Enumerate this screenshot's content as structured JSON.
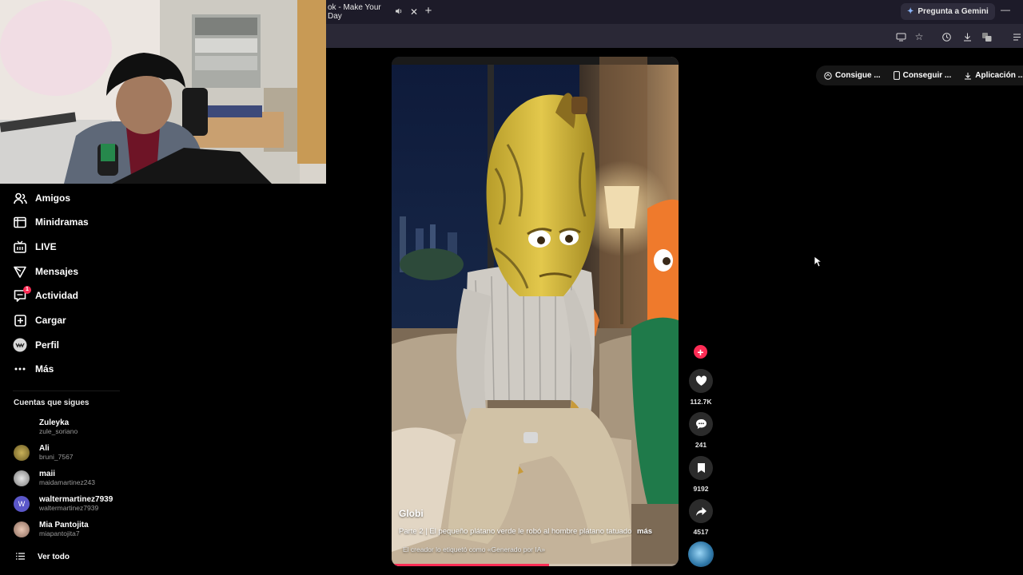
{
  "browser": {
    "tab_title": "ok - Make Your Day",
    "gemini_label": "Pregunta a Gemini",
    "toolbar_icons": [
      "screen-share-icon",
      "star-icon",
      "history-icon",
      "download-icon",
      "translate-icon",
      "reading-list-icon"
    ]
  },
  "nav": {
    "items": [
      {
        "label": "Amigos",
        "icon": "friends-icon"
      },
      {
        "label": "Minidramas",
        "icon": "minidramas-icon"
      },
      {
        "label": "LIVE",
        "icon": "live-icon"
      },
      {
        "label": "Mensajes",
        "icon": "messages-icon"
      },
      {
        "label": "Actividad",
        "icon": "activity-icon",
        "badge": "1"
      },
      {
        "label": "Cargar",
        "icon": "upload-icon"
      },
      {
        "label": "Perfil",
        "icon": "profile-avatar"
      },
      {
        "label": "Más",
        "icon": "more-icon"
      }
    ]
  },
  "following": {
    "title": "Cuentas que sigues",
    "accounts": [
      {
        "name": "Zuleyka",
        "handle": "zule_soriano"
      },
      {
        "name": "Ali",
        "handle": "bruni_7567"
      },
      {
        "name": "maii",
        "handle": "maidamartinez243"
      },
      {
        "name": "waltermartinez7939",
        "handle": "waltermartinez7939",
        "initial": "W"
      },
      {
        "name": "Mia Pantojita",
        "handle": "miapantojita7"
      }
    ],
    "see_all": "Ver todo"
  },
  "top_pills": [
    "Consigue ...",
    "Conseguir ...",
    "Aplicación ..."
  ],
  "video": {
    "author": "Globi",
    "caption": "Parte 2 | El pequeño plátano verde le robó al hombre plátano tatuado",
    "more": "más",
    "ai_label": "El creador lo etiquetó como «Generado por IA»",
    "progress": 0.55
  },
  "actions": {
    "likes": "112.7K",
    "comments": "241",
    "saves": "9192",
    "shares": "4517"
  },
  "colors": {
    "accent": "#fe2c55",
    "chrome_tab": "#1d1b29",
    "chrome_bar": "#2a2836"
  }
}
